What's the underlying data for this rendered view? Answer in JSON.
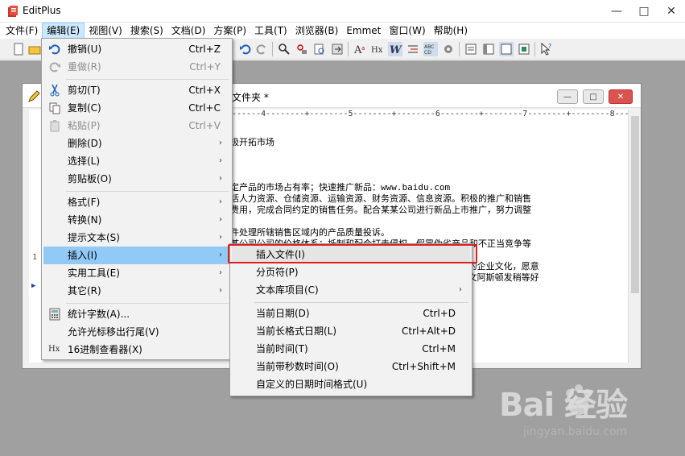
{
  "app": {
    "title": "EditPlus"
  },
  "window_controls": {
    "minimize": "—",
    "restore": "□",
    "close": "✕"
  },
  "menubar": [
    {
      "label": "文件(F)"
    },
    {
      "label": "编辑(E)"
    },
    {
      "label": "视图(V)"
    },
    {
      "label": "搜索(S)"
    },
    {
      "label": "文档(D)"
    },
    {
      "label": "方案(P)"
    },
    {
      "label": "工具(T)"
    },
    {
      "label": "浏览器(B)"
    },
    {
      "label": "Emmet"
    },
    {
      "label": "窗口(W)"
    },
    {
      "label": "帮助(H)"
    }
  ],
  "document": {
    "title": "文件夹 *",
    "ruler": "------4--------+--------5--------+--------6--------+--------7--------+--------8--------+--------9--------+----",
    "lines": [
      "极开拓市场",
      "",
      "",
      "定产品的市场占有率；快速推广新品：www.baidu.com",
      "活人力资源、仓储资源、运输资源、财务资源、信息资源。积极的推广和销售",
      "费用，完成合同约定的销售任务。配合某某公司进行新品上市推广，努力调整",
      "",
      "件处理所辖销售区域内的产品质量投诉。",
      "某公司公司的价格体系；抵制和配合打击侵权、假冒伪劣产品和不正当竞争等",
      "",
      "                                      公司公司的企业文化，愿意",
      "                                      和考核。文阿斯顿发稍等好"
    ]
  },
  "edit_menu": {
    "items": [
      {
        "label": "撤销(U)",
        "shortcut": "Ctrl+Z",
        "icon": "undo-icon"
      },
      {
        "label": "重做(R)",
        "shortcut": "Ctrl+Y",
        "icon": "redo-icon",
        "disabled": true
      },
      {
        "label": "剪切(T)",
        "shortcut": "Ctrl+X",
        "icon": "scissors-icon"
      },
      {
        "label": "复制(C)",
        "shortcut": "Ctrl+C",
        "icon": "copy-icon"
      },
      {
        "label": "粘贴(P)",
        "shortcut": "Ctrl+V",
        "icon": "paste-icon",
        "disabled": true
      },
      {
        "label": "删除(D)",
        "arrow": "›"
      },
      {
        "label": "选择(L)",
        "arrow": "›"
      },
      {
        "label": "剪贴板(O)",
        "arrow": "›"
      },
      {
        "label": "格式(F)",
        "arrow": "›"
      },
      {
        "label": "转换(N)",
        "arrow": "›"
      },
      {
        "label": "提示文本(S)",
        "arrow": "›"
      },
      {
        "label": "插入(I)",
        "arrow": "›"
      },
      {
        "label": "实用工具(E)",
        "arrow": "›"
      },
      {
        "label": "其它(R)",
        "arrow": "›"
      },
      {
        "label": "统计字数(A)...",
        "icon": "calculator-icon"
      },
      {
        "label": "允许光标移出行尾(V)"
      },
      {
        "label": "16进制查看器(X)",
        "icon": "hex-icon",
        "icon_text": "Hx"
      }
    ]
  },
  "insert_submenu": {
    "items": [
      {
        "label": "插入文件(I)"
      },
      {
        "label": "分页符(P)"
      },
      {
        "label": "文本库项目(C)",
        "arrow": "›"
      },
      {
        "label": "当前日期(D)",
        "shortcut": "Ctrl+D"
      },
      {
        "label": "当前长格式日期(L)",
        "shortcut": "Ctrl+Alt+D"
      },
      {
        "label": "当前时间(T)",
        "shortcut": "Ctrl+M"
      },
      {
        "label": "当前带秒数时间(O)",
        "shortcut": "Ctrl+Shift+M"
      },
      {
        "label": "自定义的日期时间格式(U)"
      }
    ]
  },
  "watermark": {
    "brand": "Bai 经验",
    "site": "jingyan.baidu.com"
  }
}
